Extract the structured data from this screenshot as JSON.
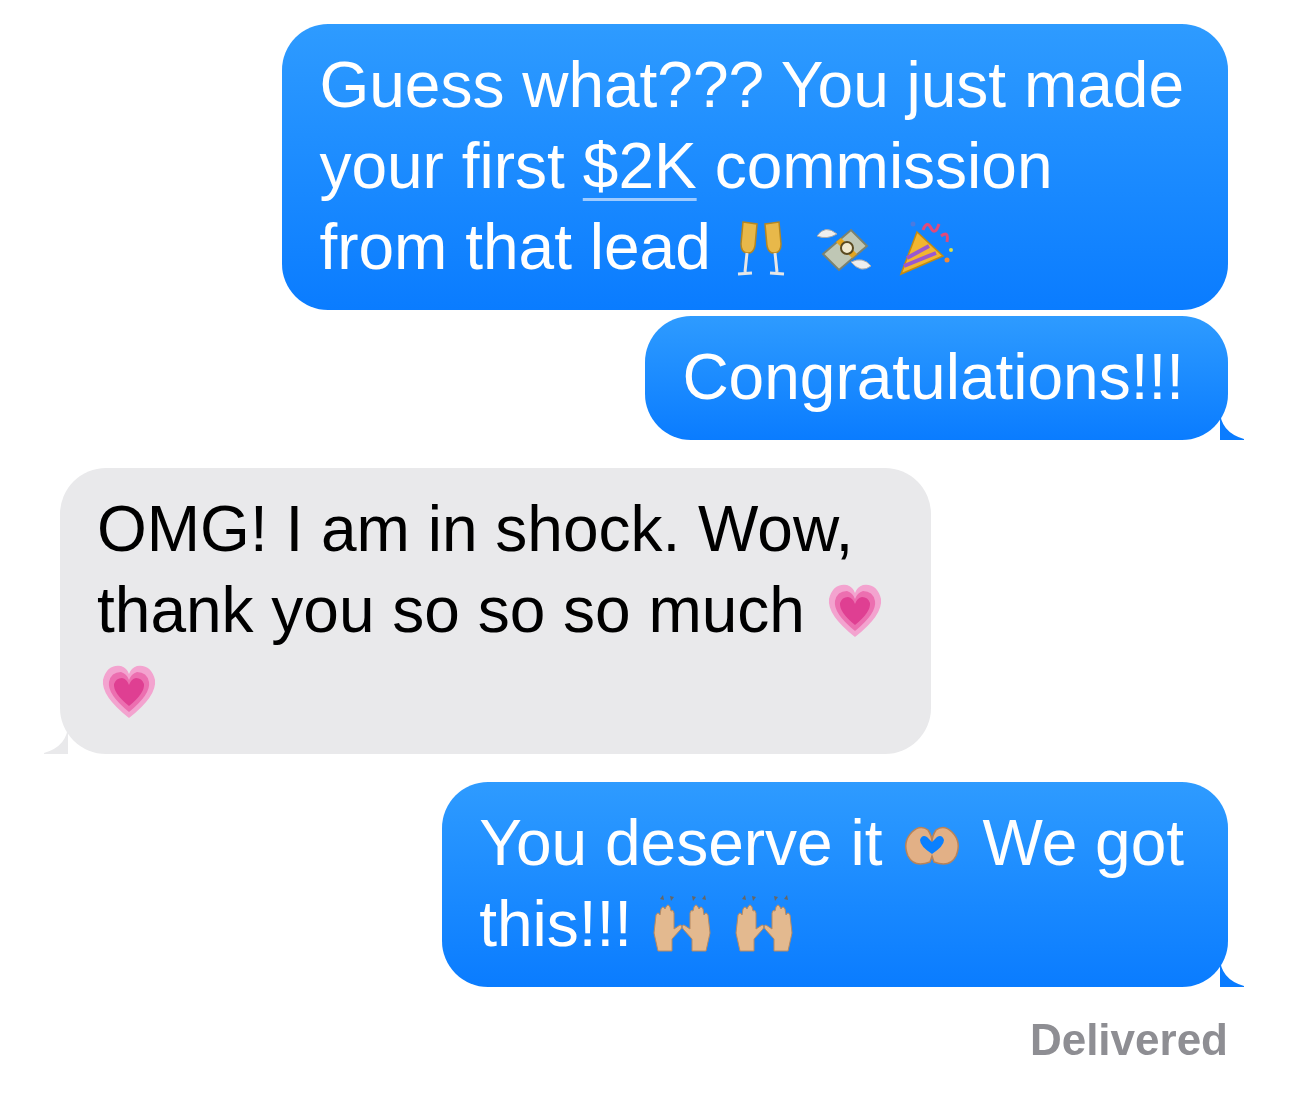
{
  "messages": [
    {
      "kind": "sent",
      "tail": false,
      "lines": [
        [
          {
            "kind": "text",
            "text": "Guess what??? You just made"
          }
        ],
        [
          {
            "kind": "text",
            "text": "your first"
          },
          {
            "kind": "link",
            "text": "$2K"
          },
          {
            "kind": "text",
            "text": "commission"
          }
        ],
        [
          {
            "kind": "text",
            "text": "from that lead"
          },
          {
            "kind": "champagne"
          },
          {
            "kind": "money"
          },
          {
            "kind": "party"
          }
        ]
      ]
    },
    {
      "kind": "sent",
      "tail": true,
      "lines": [
        [
          {
            "kind": "text",
            "text": "Congratulations!!!"
          }
        ]
      ]
    },
    {
      "kind": "received",
      "tail": true,
      "lines": [
        [
          {
            "kind": "text",
            "text": "OMG! I am in shock. Wow,"
          }
        ],
        [
          {
            "kind": "text",
            "text": "thank you so so so much"
          },
          {
            "kind": "heart"
          }
        ],
        [
          {
            "kind": "heart"
          }
        ]
      ]
    },
    {
      "kind": "sent",
      "tail": true,
      "lines": [
        [
          {
            "kind": "text",
            "text": "You deserve it"
          },
          {
            "kind": "hearthands"
          },
          {
            "kind": "text",
            "text": "We got"
          }
        ],
        [
          {
            "kind": "text",
            "text": "this!!!"
          },
          {
            "kind": "raised"
          },
          {
            "kind": "raised"
          }
        ]
      ]
    }
  ],
  "status": "Delivered"
}
